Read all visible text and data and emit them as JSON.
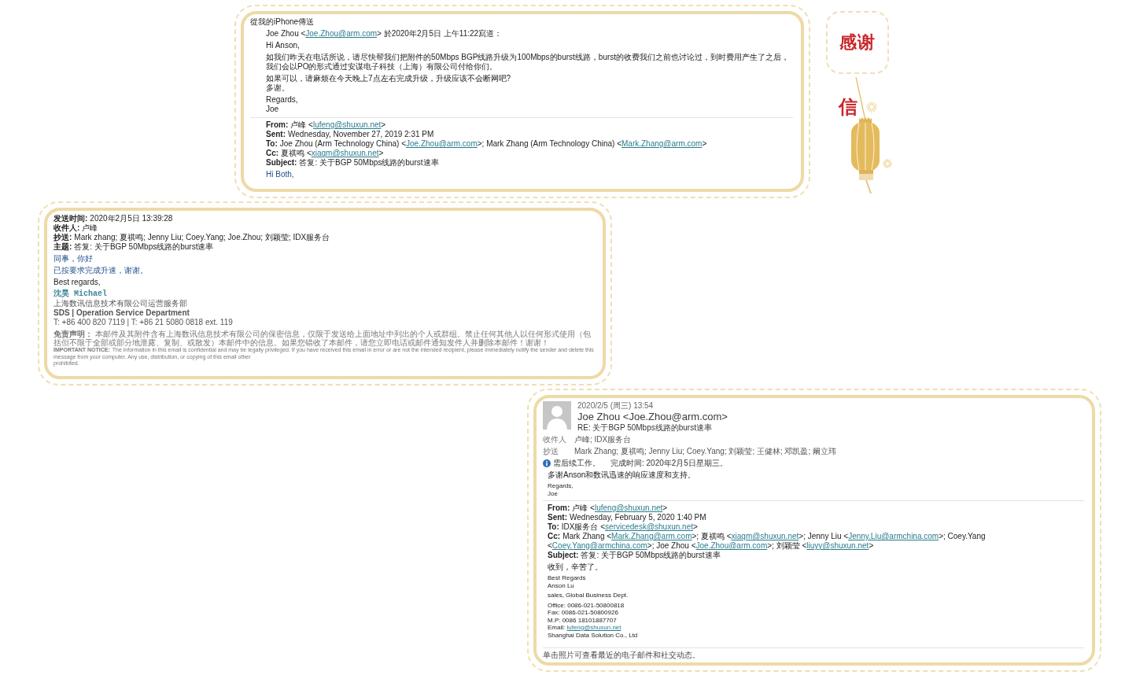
{
  "cards": [
    {
      "sent_from": "從我的iPhone傳送",
      "paragraphs": [
        [
          {
            "kind": "plain",
            "parts": [
              {
                "text": "Joe Zhou <"
              },
              {
                "link": "Joe.Zhou@arm.com"
              },
              {
                "text": "> 於2020年2月5日 上午11:22寫道："
              }
            ]
          }
        ],
        [
          {
            "kind": "plain",
            "text": "Hi Anson,"
          }
        ],
        [
          {
            "kind": "plain",
            "text": "如我们昨天在电话所说，请尽快帮我们把附件的50Mbps BGP线路升级为100Mbps的burst线路，burst的收费我们之前也讨论过，到时费用产生了之后，我们会以PO的形式通过安谋电子科技（上海）有限公司付给你们。"
          }
        ],
        [
          {
            "kind": "plain",
            "text": "如果可以，请麻烦在今天晚上7点左右完成升级，升级应该不会断网吧?"
          },
          {
            "kind": "plain",
            "text": "多谢。"
          }
        ],
        [
          {
            "kind": "plain",
            "text": "Regards,"
          },
          {
            "kind": "plain",
            "text": "Joe"
          }
        ]
      ],
      "quoted": [
        [
          {
            "kind": "plain",
            "label": "From:",
            "parts": [
              {
                "text": "卢峰 <"
              },
              {
                "link": "lufeng@shuxun.net"
              },
              {
                "text": ">"
              }
            ]
          },
          {
            "kind": "plain",
            "label": "Sent:",
            "text": "Wednesday, November 27, 2019 2:31 PM"
          },
          {
            "kind": "plain",
            "label": "To:",
            "parts": [
              {
                "text": "Joe Zhou (Arm Technology China) <"
              },
              {
                "link": "Joe.Zhou@arm.com"
              },
              {
                "text": ">; Mark Zhang (Arm Technology China) <"
              },
              {
                "link": "Mark.Zhang@arm.com"
              },
              {
                "text": ">"
              }
            ]
          },
          {
            "kind": "plain",
            "label": "Cc:",
            "parts": [
              {
                "text": "夏祺鸣 <"
              },
              {
                "link": "xiaqm@shuxun.net"
              },
              {
                "text": ">"
              }
            ]
          },
          {
            "kind": "plain",
            "label": "Subject:",
            "text": "答复: 关于BGP 50Mbps线路的burst速率"
          }
        ],
        [
          {
            "kind": "accent",
            "text": "Hi Both,"
          }
        ]
      ]
    },
    {
      "paragraphs": [
        [
          {
            "kind": "plain",
            "label": "发送时间:",
            "text": "2020年2月5日 13:39:28"
          },
          {
            "kind": "plain",
            "label": "收件人:",
            "text": "卢峰"
          },
          {
            "kind": "plain",
            "label": "抄送:",
            "text": "Mark zhang; 夏祺鸣; Jenny Liu; Coey.Yang; Joe.Zhou; 刘颖莹; IDX服务台"
          },
          {
            "kind": "plain",
            "label": "主题:",
            "text": "答复: 关于BGP 50Mbps线路的burst速率"
          }
        ],
        [
          {
            "kind": "accent",
            "text": "同事，你好"
          }
        ],
        [
          {
            "kind": "accent",
            "text": "已按要求完成升速，谢谢。"
          }
        ],
        [
          {
            "kind": "plain",
            "text": "Best regards,"
          }
        ],
        [
          {
            "kind": "name",
            "text": "沈昊 Michael"
          },
          {
            "kind": "muted",
            "text": "上海数讯信息技术有限公司运营服务部"
          },
          {
            "kind": "muted_bold",
            "text": "SDS | Operation Service Department"
          },
          {
            "kind": "muted",
            "text": "T: +86 400 820 7119 | T: +86 21 5080 0818 ext. 119"
          }
        ],
        [
          {
            "kind": "notice",
            "label": "免责声明：",
            "text": "本邮件及其附件含有上海数讯信息技术有限公司的保密信息，仅限于发送给上面地址中列出的个人或群组。禁止任何其他人以任何形式使用（包括但不限于全部或部分地泄露、复制、或散发）本邮件中的信息。如果您错收了本邮件，请您立即电话或邮件通知发件人并删除本邮件！谢谢！"
          },
          {
            "kind": "fine_print",
            "label": "IMPORTANT NOTICE:",
            "text": "The information in this email is confidential and may be legally privileged. If you have received this email in error or are not the intended recipient, please immediately notify the sender and delete this message from your computer. Any use, distribution, or copying of this email other"
          },
          {
            "kind": "fine_print",
            "text": "prohibited."
          }
        ]
      ]
    },
    {
      "header": {
        "date": "2020/2/5 (周三) 13:54",
        "sender": "Joe Zhou <Joe.Zhou@arm.com>",
        "subject": "RE: 关于BGP 50Mbps线路的burst速率"
      },
      "fields": [
        {
          "label": "收件人",
          "value": "卢峰; IDX服务台"
        },
        {
          "label": "抄送",
          "value": "Mark Zhang; 夏祺鸣; Jenny Liu; Coey.Yang; 刘颖莹; 王健林; 邓凯盈; 阚立玮"
        }
      ],
      "flag": {
        "status": "需后续工作。",
        "due": "完成时间: 2020年2月5日星期三。"
      },
      "paragraphs": [
        [
          {
            "kind": "plain",
            "text": "多谢Anson和数讯迅速的响应速度和支持。"
          }
        ],
        [
          {
            "kind": "small",
            "text": "Regards,"
          },
          {
            "kind": "small",
            "text": "Joe"
          }
        ]
      ],
      "quoted": [
        [
          {
            "kind": "plain",
            "label": "From:",
            "parts": [
              {
                "text": "卢峰 <"
              },
              {
                "link": "lufeng@shuxun.net"
              },
              {
                "text": ">"
              }
            ]
          },
          {
            "kind": "plain",
            "label": "Sent:",
            "text": "Wednesday, February 5, 2020 1:40 PM"
          },
          {
            "kind": "plain",
            "label": "To:",
            "parts": [
              {
                "text": "IDX服务台 <"
              },
              {
                "link": "servicedesk@shuxun.net"
              },
              {
                "text": ">"
              }
            ]
          },
          {
            "kind": "plain",
            "label": "Cc:",
            "parts": [
              {
                "text": "Mark Zhang <"
              },
              {
                "link": "Mark.Zhang@arm.com"
              },
              {
                "text": ">; 夏祺鸣 <"
              },
              {
                "link": "xiaqm@shuxun.net"
              },
              {
                "text": ">; Jenny Liu <"
              },
              {
                "link": "Jenny.Liu@armchina.com"
              },
              {
                "text": ">; Coey.Yang <"
              },
              {
                "link": "Coey.Yang@armchina.com"
              },
              {
                "text": ">; Joe Zhou <"
              },
              {
                "link": "Joe.Zhou@arm.com"
              },
              {
                "text": ">; 刘颖莹 <"
              },
              {
                "link": "liuyy@shuxun.net"
              },
              {
                "text": ">"
              }
            ]
          },
          {
            "kind": "plain",
            "label": "Subject:",
            "text": "答复: 关于BGP 50Mbps线路的burst速率"
          }
        ],
        [
          {
            "kind": "plain",
            "text": "收到，辛苦了。"
          }
        ],
        [
          {
            "kind": "small",
            "text": "Best Regards"
          },
          {
            "kind": "small",
            "text": "Anson Lu"
          }
        ],
        [
          {
            "kind": "small",
            "text": "sales, Global Business Dept."
          }
        ],
        [
          {
            "kind": "small",
            "text": "Office: 0086-021-50800818"
          },
          {
            "kind": "small",
            "text": "Fax: 0086-021-50800926"
          },
          {
            "kind": "small",
            "text": "M.P: 0086 18101887707"
          },
          {
            "kind": "small",
            "parts": [
              {
                "text": "Email: "
              },
              {
                "link": "lufeng@shuxun.net"
              }
            ]
          },
          {
            "kind": "small",
            "text": "Shanghai Data Solution Co., Ltd"
          }
        ]
      ],
      "footer": "单击照片可查看最近的电子邮件和社交动态。"
    }
  ],
  "banner": {
    "title": "感谢",
    "side": "信"
  }
}
